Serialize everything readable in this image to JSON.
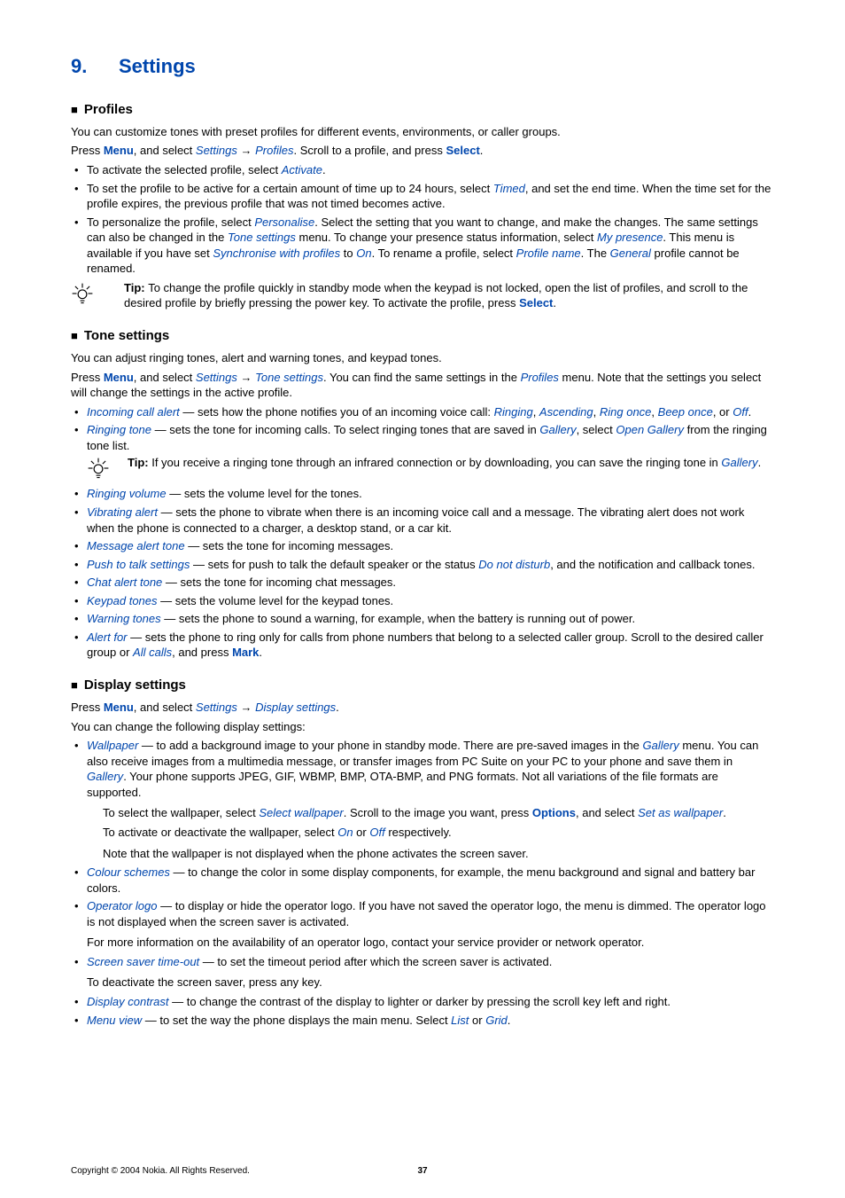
{
  "chapter_number": "9.",
  "chapter_title": "Settings",
  "sec_profiles": "Profiles",
  "profiles_intro": "You can customize tones with preset profiles for different events, environments, or caller groups.",
  "profiles_press_a": "Press ",
  "menu": "Menu",
  "profiles_press_b": ", and select ",
  "settings": "Settings",
  "profiles_arrow": " → ",
  "profiles_word": "Profiles",
  "profiles_press_c": ". Scroll to a profile, and press ",
  "select": "Select",
  "dot": ".",
  "p_li1_a": "To activate the selected profile, select ",
  "activate": "Activate",
  "p_li2_a": "To set the profile to be active for a certain amount of time up to 24 hours, select ",
  "timed": "Timed",
  "p_li2_b": ", and set the end time. When the time set for the profile expires, the previous profile that was not timed becomes active.",
  "p_li3_a": "To personalize the profile, select ",
  "personalise": "Personalise",
  "p_li3_b": ". Select the setting that you want to change, and make the changes. The same settings can also be changed in the ",
  "tone_settings": "Tone settings",
  "p_li3_c": " menu. To change your presence status information, select ",
  "my_presence": "My presence",
  "p_li3_d": ". This menu is available if you have set ",
  "sync_profiles": "Synchronise with profiles",
  "p_li3_e": " to ",
  "on": "On",
  "p_li3_f": ". To rename a profile, select ",
  "profile_name": "Profile name",
  "p_li3_g": ". The ",
  "general": "General",
  "p_li3_h": " profile cannot be renamed.",
  "tip1_label": "Tip: ",
  "tip1_a": "To change the profile quickly in standby mode when the keypad is not locked, open the list of profiles, and scroll to the desired profile by briefly pressing the power key. To activate the profile, press ",
  "sec_tone": "Tone settings",
  "tone_intro": "You can adjust ringing tones, alert and warning tones, and keypad tones.",
  "tone_p_a": "Press ",
  "tone_p_b": ", and select ",
  "tone_p_c": ". You can find the same settings in the ",
  "tone_p_d": " menu. Note that the settings you select will change the settings in the active profile.",
  "t_li1_key": "Incoming call alert",
  "t_li1_a": " — sets how the phone notifies you of an incoming voice call: ",
  "ringing": "Ringing",
  "comma": ", ",
  "ascending": "Ascending",
  "ring_once": "Ring once",
  "beep_once": "Beep once",
  "t_li1_b": ", or ",
  "off": "Off",
  "t_li2_key": "Ringing tone",
  "t_li2_a": " — sets the tone for incoming calls. To select ringing tones that are saved in ",
  "gallery": "Gallery",
  "t_li2_b": ", select ",
  "open_gallery": "Open Gallery",
  "t_li2_c": " from the ringing tone list.",
  "tip2_label": "Tip: ",
  "tip2_a": "If you receive a ringing tone through an infrared connection or by downloading, you can save the ringing tone in ",
  "t_li3_key": "Ringing volume",
  "t_li3_a": " — sets the volume level for the tones.",
  "t_li4_key": "Vibrating alert",
  "t_li4_a": " — sets the phone to vibrate when there is an incoming voice call and a message. The vibrating alert does not work when the phone is connected to a charger, a desktop stand, or a car kit.",
  "t_li5_key": "Message alert tone",
  "t_li5_a": " — sets the tone for incoming messages.",
  "t_li6_key": "Push to talk settings",
  "t_li6_a": " — sets for push to talk the default speaker or the status ",
  "dnd": "Do not disturb",
  "t_li6_b": ", and the notification and callback tones.",
  "t_li7_key": "Chat alert tone",
  "t_li7_a": " — sets the tone for incoming chat messages.",
  "t_li8_key": "Keypad tones",
  "t_li8_a": " — sets the volume level for the keypad tones.",
  "t_li9_key": "Warning tones",
  "t_li9_a": " — sets the phone to sound a warning, for example, when the battery is running out of power.",
  "t_li10_key": "Alert for",
  "t_li10_a": " — sets the phone to ring only for calls from phone numbers that belong to a selected caller group. Scroll to the desired caller group or ",
  "all_calls": "All calls",
  "t_li10_b": ", and press ",
  "mark": "Mark",
  "sec_display": "Display settings",
  "disp_p_a": "Press ",
  "disp_p_b": ", and select ",
  "display_settings": "Display settings",
  "disp_intro": "You can change the following display settings:",
  "d_li1_key": "Wallpaper",
  "d_li1_a": " — to add a background image to your phone in standby mode. There are pre-saved images in the ",
  "d_li1_b": " menu. You can also receive images from a multimedia message, or transfer images from PC Suite on your PC to your phone and save them in ",
  "d_li1_c": ". Your phone supports JPEG, GIF, WBMP, BMP, OTA-BMP, and PNG formats. Not all variations of the file formats are supported.",
  "d_li1_sub1_a": "To select the wallpaper, select ",
  "select_wallpaper": "Select wallpaper",
  "d_li1_sub1_b": ". Scroll to the image you want, press ",
  "options": "Options",
  "d_li1_sub1_c": ", and select ",
  "set_as_wallpaper": "Set as wallpaper",
  "d_li1_sub2_a": "To activate or deactivate the wallpaper, select ",
  "d_li1_sub2_b": " or ",
  "d_li1_sub2_c": " respectively.",
  "d_li1_sub3": "Note that the wallpaper is not displayed when the phone activates the screen saver.",
  "d_li2_key": "Colour schemes",
  "d_li2_a": " — to change the color in some display components, for example, the menu background and signal and battery bar colors.",
  "d_li3_key": "Operator logo",
  "d_li3_a": " — to display or hide the operator logo. If you have not saved the operator logo, the menu is dimmed. The operator logo is not displayed when the screen saver is activated.",
  "d_li3_sub": "For more information on the availability of an operator logo, contact your service provider or network operator.",
  "d_li4_key": "Screen saver time-out",
  "d_li4_a": " — to set the timeout period after which the screen saver is activated.",
  "d_li4_sub": "To deactivate the screen saver, press any key.",
  "d_li5_key": "Display contrast",
  "d_li5_a": " — to change the contrast of the display to lighter or darker by pressing the scroll key left and right.",
  "d_li6_key": "Menu view",
  "d_li6_a": " — to set the way the phone displays the main menu. Select ",
  "list": "List",
  "d_li6_b": " or ",
  "grid": "Grid",
  "copyright": "Copyright © 2004 Nokia. All Rights Reserved.",
  "pageno": "37"
}
